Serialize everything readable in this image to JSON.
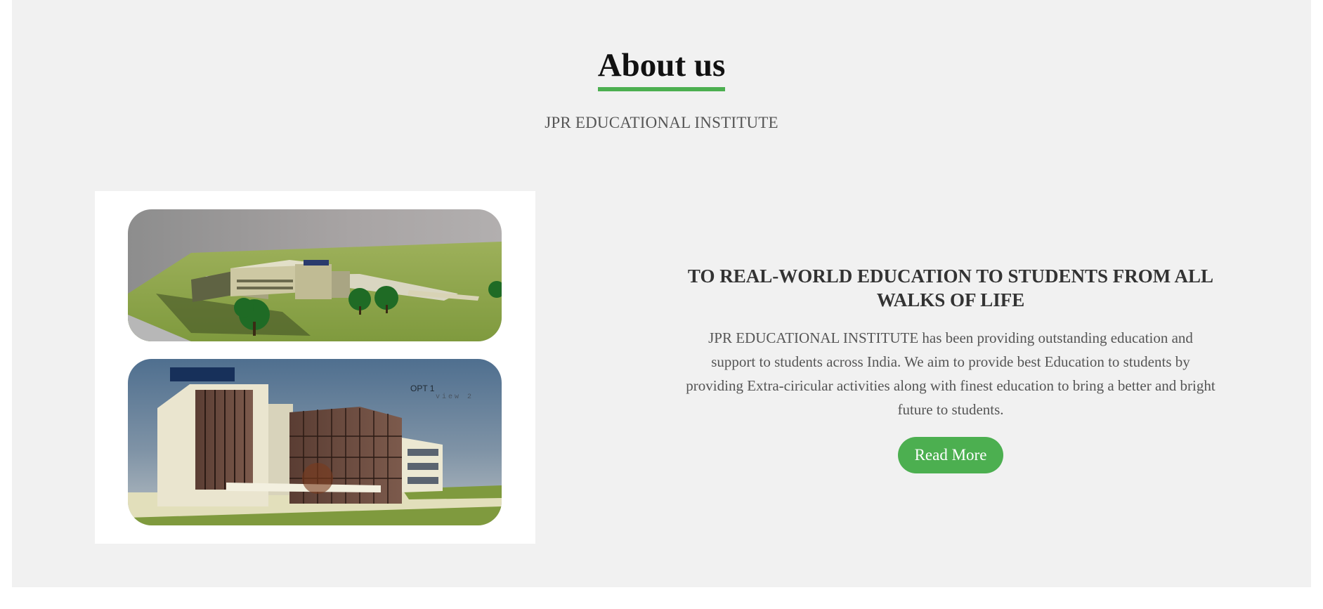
{
  "about": {
    "title": "About us",
    "subtitle": "JPR EDUCATIONAL INSTITUTE",
    "accent_color": "#4caf50",
    "image": {
      "top_render_label": "",
      "bottom_render_label": "OPT 1",
      "bottom_render_sublabel": "view 2"
    },
    "content": {
      "heading": "TO REAL-WORLD EDUCATION TO STUDENTS FROM ALL WALKS OF LIFE",
      "body": "JPR EDUCATIONAL INSTITUTE has been providing outstanding education and support to students across India. We aim to provide best Education to students by providing Extra-ciricular activities along with finest education to bring a better and bright future to students.",
      "button_label": "Read More"
    }
  }
}
